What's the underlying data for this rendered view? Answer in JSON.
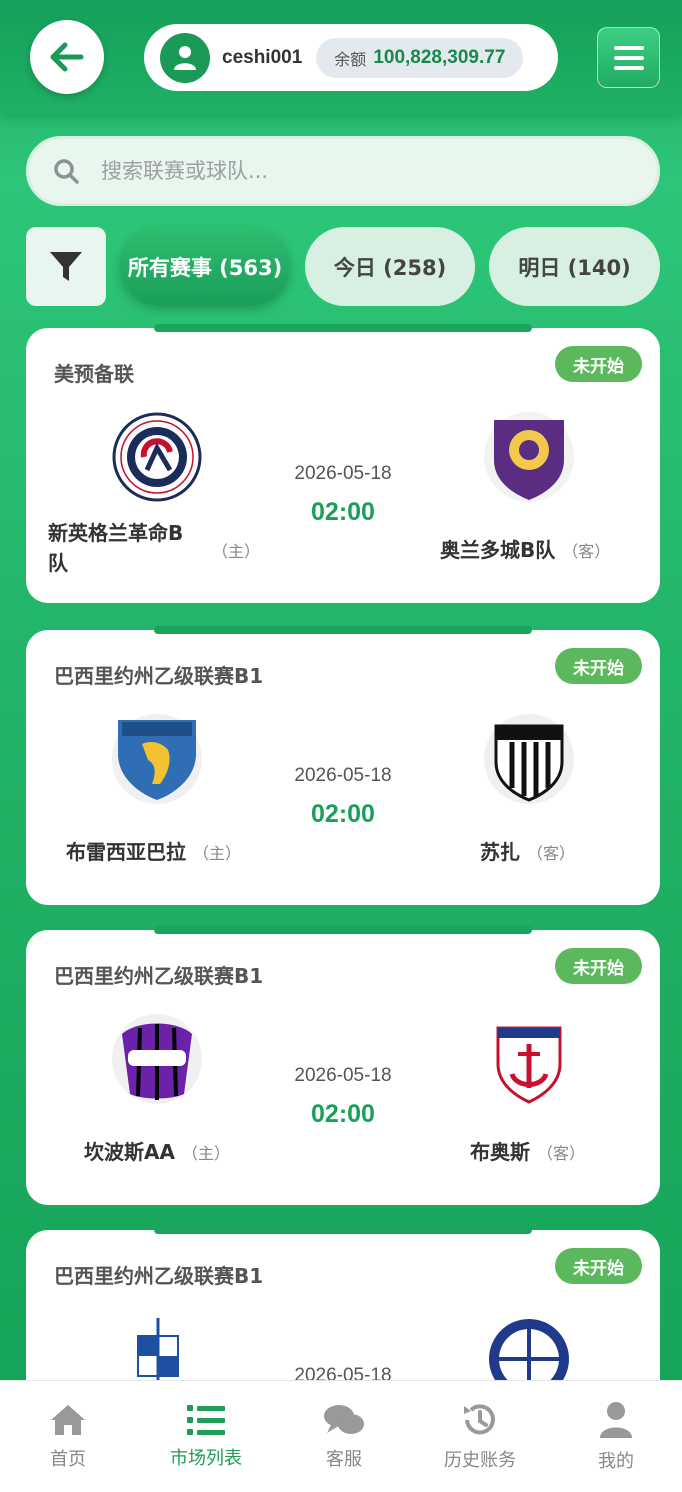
{
  "header": {
    "username": "ceshi001",
    "balance_label": "余额",
    "balance_value": "100,828,309.77"
  },
  "search": {
    "placeholder": "搜索联赛或球队..."
  },
  "tabs": [
    {
      "label": "所有赛事 (563)",
      "active": true
    },
    {
      "label": "今日 (258)",
      "active": false
    },
    {
      "label": "明日 (140)",
      "active": false
    }
  ],
  "matches": [
    {
      "league": "美预备联",
      "status": "未开始",
      "home": {
        "name": "新英格兰革命B队",
        "role": "（主）",
        "logo": "new-england-revolution-logo"
      },
      "away": {
        "name": "奥兰多城B队",
        "role": "（客）",
        "logo": "orlando-city-logo"
      },
      "date": "2026-05-18",
      "time": "02:00"
    },
    {
      "league": "巴西里约州乙级联赛B1",
      "status": "未开始",
      "home": {
        "name": "布雷西亚巴拉",
        "role": "（主）",
        "logo": "brescia-logo"
      },
      "away": {
        "name": "苏扎",
        "role": "（客）",
        "logo": "sousa-logo"
      },
      "date": "2026-05-18",
      "time": "02:00"
    },
    {
      "league": "巴西里约州乙级联赛B1",
      "status": "未开始",
      "home": {
        "name": "坎波斯AA",
        "role": "（主）",
        "logo": "cra-logo"
      },
      "away": {
        "name": "布奥斯",
        "role": "（客）",
        "logo": "anchor-crest-logo"
      },
      "date": "2026-05-18",
      "time": "02:00"
    },
    {
      "league": "巴西里约州乙级联赛B1",
      "status": "未开始",
      "home": {
        "name": "",
        "role": "",
        "logo": "vec-logo"
      },
      "away": {
        "name": "",
        "role": "",
        "logo": "bfmc-logo"
      },
      "date": "2026-05-18",
      "time": ""
    }
  ],
  "bottom_nav": [
    {
      "label": "首页",
      "icon": "home-icon",
      "active": false
    },
    {
      "label": "市场列表",
      "icon": "list-icon",
      "active": true
    },
    {
      "label": "客服",
      "icon": "chat-icon",
      "active": false
    },
    {
      "label": "历史账务",
      "icon": "history-icon",
      "active": false
    },
    {
      "label": "我的",
      "icon": "user-icon",
      "active": false
    }
  ],
  "colors": {
    "brand_green": "#1aa05a",
    "status_green": "#5cb85c"
  }
}
